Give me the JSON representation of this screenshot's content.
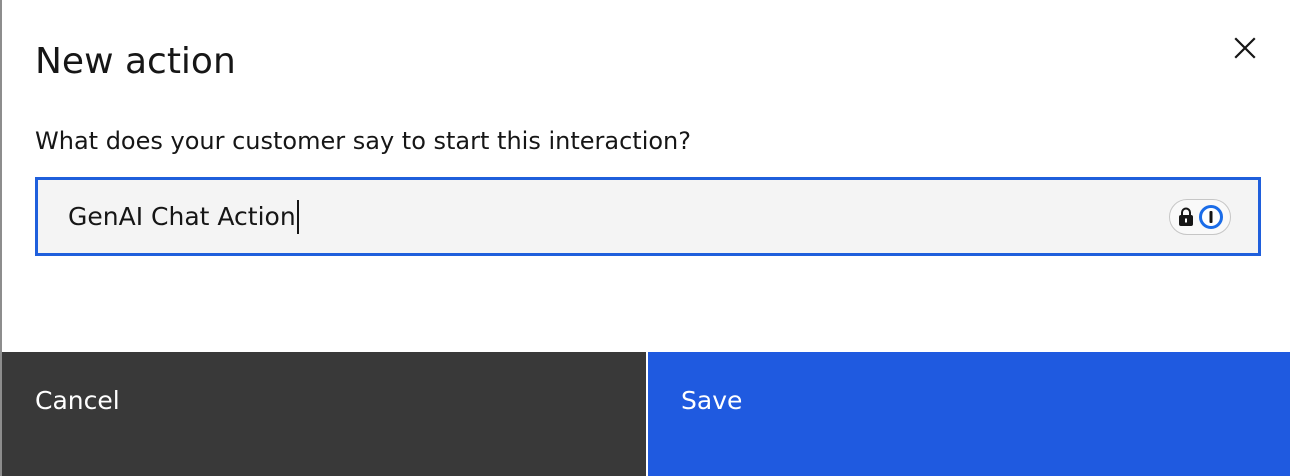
{
  "modal": {
    "title": "New action",
    "close_icon": "close-icon",
    "prompt_label": "What does your customer say to start this interaction?",
    "input": {
      "value": "GenAI Chat Action",
      "focused": true,
      "extension_icons": [
        "lock-icon",
        "password-manager-icon"
      ]
    },
    "footer": {
      "cancel_label": "Cancel",
      "save_label": "Save"
    }
  },
  "colors": {
    "primary": "#1f5ae0",
    "focus_border": "#1f5fdc",
    "secondary_button": "#393939",
    "input_background": "#f4f4f4",
    "text": "#161616"
  }
}
